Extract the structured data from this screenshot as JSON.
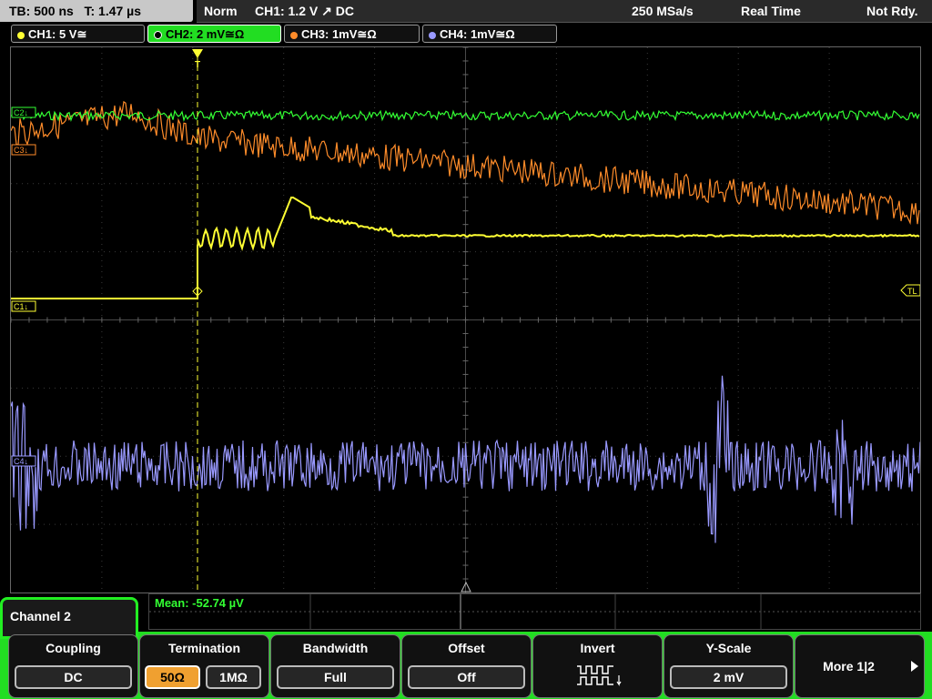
{
  "header": {
    "tb": "TB: 500 ns",
    "t": "T: 1.47 µs",
    "mode": "Norm",
    "trigger": "CH1: 1.2 V ↗ DC",
    "samplerate": "250 MSa/s",
    "acq": "Real Time",
    "ready": "Not Rdy."
  },
  "channels": [
    {
      "label": "CH1: 5 V≅",
      "color": "#ffff33"
    },
    {
      "label": "CH2: 2 mV≅Ω",
      "color": "#33ff33"
    },
    {
      "label": "CH3: 1mV≅Ω",
      "color": "#ff8c2a"
    },
    {
      "label": "CH4: 1mV≅Ω",
      "color": "#9999ff"
    }
  ],
  "markers": {
    "c1": "C1↓",
    "c2": "C2↓",
    "c3": "C3↓",
    "c4": "C4↓",
    "tl": "TL",
    "trig": "T"
  },
  "measurement": {
    "label": "Mean: -52.74 µV"
  },
  "menu": {
    "title": "Channel 2",
    "coupling": {
      "caption": "Coupling",
      "value": "DC"
    },
    "termination": {
      "caption": "Termination",
      "opt1": "50Ω",
      "opt2": "1MΩ"
    },
    "bandwidth": {
      "caption": "Bandwidth",
      "value": "Full"
    },
    "offset": {
      "caption": "Offset",
      "value": "Off"
    },
    "invert": {
      "caption": "Invert",
      "icon": "invert-waveform-icon"
    },
    "yscale": {
      "caption": "Y-Scale",
      "value": "2 mV"
    },
    "more": {
      "caption": "More 1|2"
    }
  }
}
